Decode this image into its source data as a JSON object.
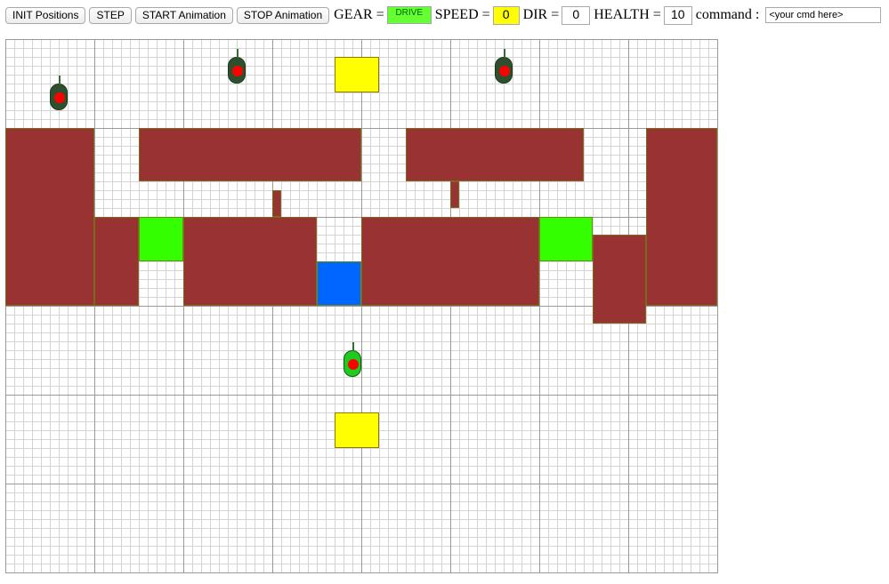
{
  "toolbar": {
    "init_label": "INIT Positions",
    "step_label": "STEP",
    "start_label": "START Animation",
    "stop_label": "STOP Animation",
    "gear_label": "GEAR =",
    "gear_value": "DRIVE",
    "speed_label": "SPEED =",
    "speed_value": "0",
    "dir_label": "DIR =",
    "dir_value": "0",
    "health_label": "HEALTH =",
    "health_value": "10",
    "command_label": "command :",
    "command_value": "<your cmd here>"
  },
  "colors": {
    "wall": "#993333",
    "gear_box": "#66ff33",
    "speed_box": "#ffff00",
    "target_green": "#33ff00",
    "target_blue": "#0066ff",
    "target_yellow": "#ffff00",
    "enemy_bot": "#2f4f2f",
    "player_bot": "#1ecb1e",
    "bot_eye": "#ff0000"
  }
}
